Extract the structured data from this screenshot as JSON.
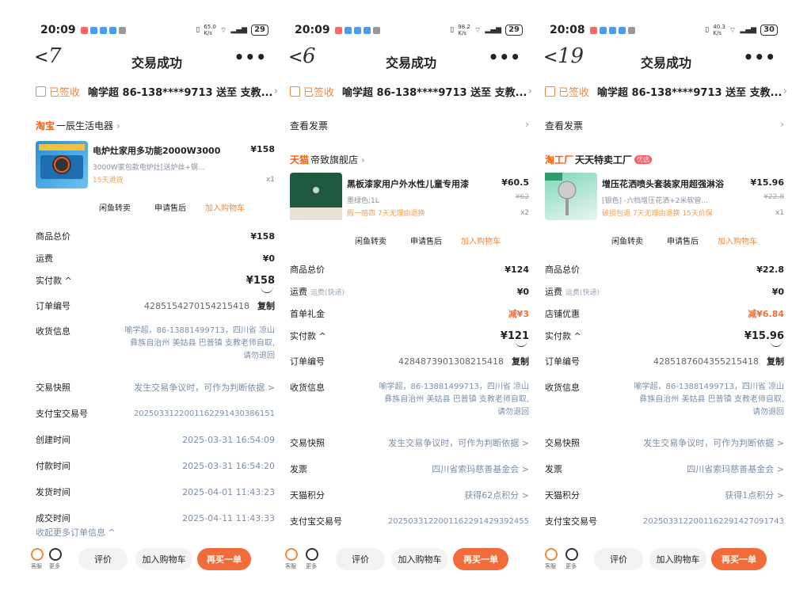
{
  "panels": [
    {
      "status": {
        "time": "20:09",
        "net": "65.0\nK/s",
        "battery": "29"
      },
      "nav": {
        "back": "<",
        "handwritten": "7",
        "title": "交易成功",
        "more": "•••"
      },
      "signed": {
        "status": "已签收",
        "address": "喻学超  86-138****9713  送至  支教..."
      },
      "store": {
        "brand": "淘宝",
        "name": "一辰生活电器"
      },
      "product": {
        "name": "电炉灶家用多功能2000W3000",
        "spec": "3000W家包款电炉灶[送炉丝+钢...",
        "tag": "15天退货",
        "price": "¥158",
        "qty": "x1"
      },
      "actions": [
        "闲鱼转卖",
        "申请售后",
        "加入购物车"
      ],
      "rows": [
        {
          "label": "商品总价",
          "value": "¥158"
        },
        {
          "label": "运费",
          "value": "¥0"
        },
        {
          "label": "实付款 ^",
          "value": "¥158"
        },
        {
          "label": "订单编号",
          "value": "4285154270154215418",
          "copy": "复制"
        },
        {
          "label": "收货信息",
          "value": ""
        },
        {
          "label": "交易快照",
          "value": "发生交易争议时，可作为判断依据 >"
        },
        {
          "label": "支付宝交易号",
          "value": "2025033122001162291430386151"
        },
        {
          "label": "创建时间",
          "value": "2025-03-31 16:54:09"
        },
        {
          "label": "付款时间",
          "value": "2025-03-31 16:54:20"
        },
        {
          "label": "发货时间",
          "value": "2025-04-01 11:43:23"
        },
        {
          "label": "成交时间",
          "value": "2025-04-11 11:43:33"
        }
      ],
      "address_lines": [
        "喻学超，86-13881499713，四川省 凉山",
        "彝族自治州 美姑县 巴普镇 支教老师自取,",
        "请勿退回"
      ],
      "more_info": "收起更多订单信息 ^",
      "bottom": {
        "service": "客服",
        "more": "更多",
        "review": "评价",
        "cart": "加入购物车",
        "rebuy": "再买一单"
      }
    },
    {
      "status": {
        "time": "20:09",
        "net": "98.2\nK/s",
        "battery": "29"
      },
      "nav": {
        "back": "<",
        "handwritten": "6",
        "title": "交易成功",
        "more": "•••"
      },
      "signed": {
        "status": "已签收",
        "address": "喻学超  86-138****9713  送至  支教..."
      },
      "invoice": "查看发票",
      "store": {
        "brand": "天猫",
        "name": "帝致旗舰店"
      },
      "product": {
        "name": "黑板漆家用户外水性儿童专用漆",
        "spec": "墨绿色;1L",
        "tag": "假一赔四  7天无理由退换",
        "price": "¥60.5",
        "oprice": "¥62",
        "qty": "x2"
      },
      "actions": [
        "闲鱼转卖",
        "申请售后",
        "加入购物车"
      ],
      "rows": [
        {
          "label": "商品总价",
          "value": "¥124"
        },
        {
          "label": "运费",
          "note": "运费(快递)",
          "value": "¥0"
        },
        {
          "label": "首单礼金",
          "value": "减¥3"
        },
        {
          "label": "实付款 ^",
          "value": "¥121"
        },
        {
          "label": "订单编号",
          "value": "4284873901308215418",
          "copy": "复制"
        },
        {
          "label": "收货信息",
          "value": ""
        },
        {
          "label": "交易快照",
          "value": "发生交易争议时，可作为判断依据 >"
        },
        {
          "label": "发票",
          "value": "四川省索玛慈善基金会 >"
        },
        {
          "label": "天猫积分",
          "value": "获得62点积分 >"
        },
        {
          "label": "支付宝交易号",
          "value": "2025033122001162291429392455"
        }
      ],
      "address_lines": [
        "喻学超，86-13881499713，四川省 凉山",
        "彝族自治州 美姑县 巴普镇 支教老师自取,",
        "请勿退回"
      ],
      "bottom": {
        "service": "客服",
        "more": "更多",
        "review": "评价",
        "cart": "加入购物车",
        "rebuy": "再买一单"
      }
    },
    {
      "status": {
        "time": "20:08",
        "net": "40.3\nK/s",
        "battery": "30"
      },
      "nav": {
        "back": "<",
        "handwritten": "19",
        "title": "交易成功",
        "more": "•••"
      },
      "signed": {
        "status": "已签收",
        "address": "喻学超  86-138****9713  送至  支教..."
      },
      "invoice": "查看发票",
      "store": {
        "brand": "淘工厂",
        "name": "天天特卖工厂",
        "badge": "优选"
      },
      "product": {
        "name": "增压花洒喷头套装家用超强淋浴",
        "spec": "[银色] -六档增压花洒+2米软管...",
        "tag": "破损包退  7天无理由退换  15天价保",
        "price": "¥15.96",
        "oprice": "¥22.8",
        "qty": "x1"
      },
      "actions": [
        "闲鱼转卖",
        "申请售后",
        "加入购物车"
      ],
      "rows": [
        {
          "label": "商品总价",
          "value": "¥22.8"
        },
        {
          "label": "运费",
          "note": "运费(快递)",
          "value": "¥0"
        },
        {
          "label": "店铺优惠",
          "value": "减¥6.84"
        },
        {
          "label": "实付款 ^",
          "value": "¥15.96"
        },
        {
          "label": "订单编号",
          "value": "4285187604355215418",
          "copy": "复制"
        },
        {
          "label": "收货信息",
          "value": ""
        },
        {
          "label": "交易快照",
          "value": "发生交易争议时，可作为判断依据 >"
        },
        {
          "label": "发票",
          "value": "四川省索玛慈善基金会 >"
        },
        {
          "label": "天猫积分",
          "value": "获得1点积分 >"
        },
        {
          "label": "支付宝交易号",
          "value": "2025033122001162291427091743"
        }
      ],
      "address_lines": [
        "喻学超，86-13881499713，四川省 凉山",
        "彝族自治州 美姑县 巴普镇 支教老师自取,",
        "请勿退回"
      ],
      "bottom": {
        "service": "客服",
        "more": "更多",
        "review": "评价",
        "cart": "加入购物车",
        "rebuy": "再买一单"
      }
    }
  ]
}
